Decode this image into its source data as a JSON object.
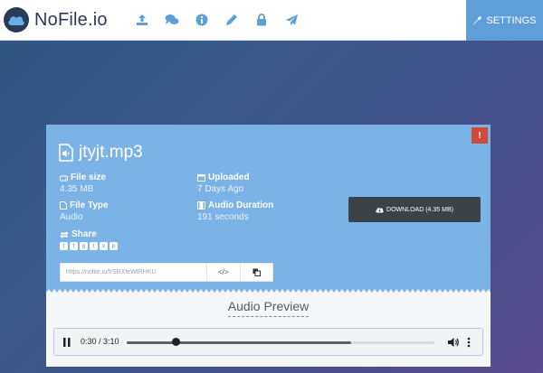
{
  "nav": {
    "brand": "NoFile.io",
    "icons": [
      "upload-icon",
      "chat-icon",
      "info-icon",
      "pencil-icon",
      "lock-icon",
      "paper-plane-icon"
    ],
    "settings_label": "SETTINGS",
    "settings_color": "#5f9fd9"
  },
  "file": {
    "name": "jtyjt.mp3",
    "report_label": "!",
    "size_label": "File size",
    "size_value": "4.35 MB",
    "uploaded_label": "Uploaded",
    "uploaded_value": "7 Days Ago",
    "type_label": "File Type",
    "type_value": "Audio",
    "duration_label": "Audio Duration",
    "duration_value": "191 seconds",
    "share_label": "Share",
    "share_networks": [
      "twitter",
      "facebook",
      "google-plus",
      "tumblr",
      "vk",
      "pinterest"
    ],
    "download_label": "DOWNLOAD (4.35 MB)",
    "link_value": "https://nofile.io/f/SRXfeWtRHKU",
    "embed_label": "</>",
    "accent_color": "#7cb3e6"
  },
  "preview": {
    "title": "Audio Preview",
    "time": "0:30 / 3:10",
    "progress": 0.16,
    "buffered": 0.73
  }
}
